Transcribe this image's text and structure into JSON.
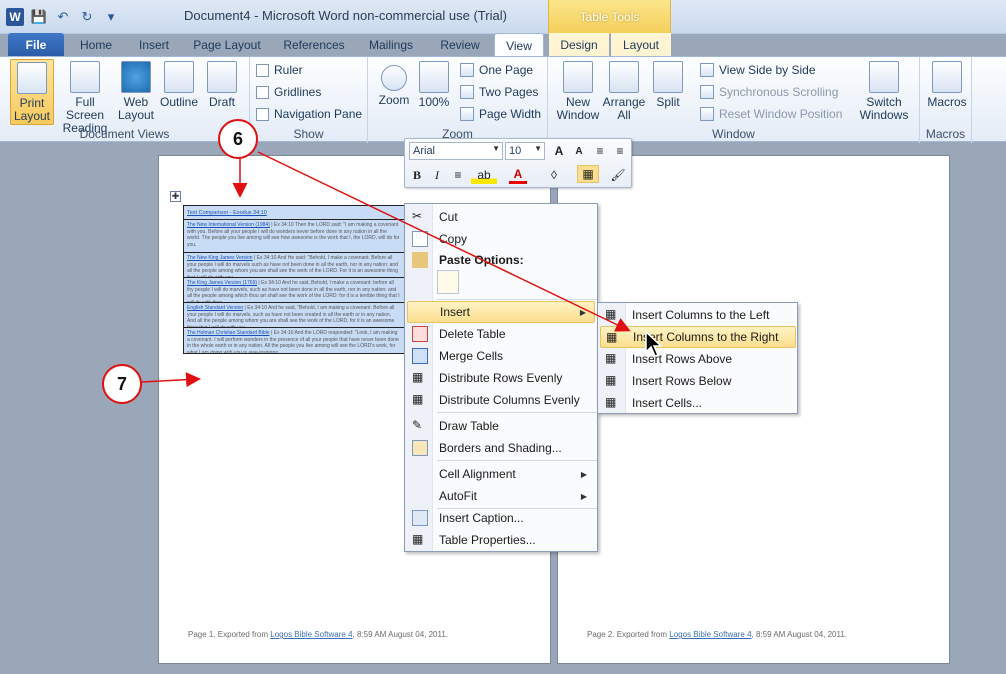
{
  "window": {
    "title": "Document4  -  Microsoft Word non-commercial use (Trial)",
    "context_tab_group": "Table Tools"
  },
  "tabs": [
    "File",
    "Home",
    "Insert",
    "Page Layout",
    "References",
    "Mailings",
    "Review",
    "View",
    "Design",
    "Layout"
  ],
  "active_tab": "View",
  "ribbon": {
    "document_views": {
      "label": "Document Views",
      "print_layout": "Print\nLayout",
      "full_screen_reading": "Full Screen\nReading",
      "web_layout": "Web\nLayout",
      "outline": "Outline",
      "draft": "Draft"
    },
    "show": {
      "label": "Show",
      "ruler": "Ruler",
      "gridlines": "Gridlines",
      "navigation_pane": "Navigation Pane"
    },
    "zoom": {
      "label": "Zoom",
      "zoom": "Zoom",
      "hundred": "100%",
      "one_page": "One Page",
      "two_pages": "Two Pages",
      "page_width": "Page Width"
    },
    "window": {
      "label": "Window",
      "new_window": "New\nWindow",
      "arrange_all": "Arrange\nAll",
      "split": "Split",
      "view_side_by_side": "View Side by Side",
      "synchronous_scrolling": "Synchronous Scrolling",
      "reset_window_position": "Reset Window Position",
      "switch_windows": "Switch\nWindows"
    },
    "macros": {
      "label": "Macros",
      "macros": "Macros"
    }
  },
  "mini_toolbar": {
    "font": "Arial",
    "size": "10"
  },
  "document": {
    "table_rows": [
      {
        "ref": "Text Comparison  -  Exodus 34:10",
        "text": ""
      },
      {
        "ref": "The New International Version (1984)",
        "text": " | Ex 34:10 Then the LORD said: \"I am making a covenant with you. Before all your people I will do wonders never before done in any nation in all the world. The people you live among will see how awesome is the work that I, the LORD, will do for you."
      },
      {
        "ref": "The New King James Version",
        "text": " | Ex 34:10 And He said: \"Behold, I make a covenant. Before all your people I will do marvels such as have not been done in all the earth, nor in any nation; and all the people among whom you are shall see the work of the LORD. For it is an awesome thing that I will do with you."
      },
      {
        "ref": "The King James Version (1769)",
        "text": " | Ex 34:10 And he said, Behold, I make a covenant: before all thy people I will do marvels, such as have not been done in all the earth, nor in any nation: and all the people among which thou art shall see the work of the LORD: for it is a terrible thing that I will do with thee."
      },
      {
        "ref": "English Standard Version",
        "text": " | Ex 34:10 And he said, \"Behold, I am making a covenant. Before all your people I will do marvels, such as have not been created in all the earth or in any nation. And all the people among whom you are shall see the work of the LORD, for it is an awesome thing that I will do with you."
      },
      {
        "ref": "The Holman Christian Standard Bible",
        "text": " | Ex 34:10 And the LORD responded: \"Look, I am making a covenant. I will perform wonders in the presence of all your people that have never been done in the whole earth or in any nation. All the people you live among will see the LORD's work, for what I am doing with you is awe-inspiring."
      }
    ],
    "footer_page1": {
      "prefix": "Page 1.  Exported from ",
      "link": "Logos Bible Software 4",
      "suffix": ", 8:59 AM August 04, 2011."
    },
    "footer_page2": {
      "prefix": "Page 2.  Exported from ",
      "link": "Logos Bible Software 4",
      "suffix": ", 8:59 AM August 04, 2011."
    }
  },
  "context_menu": {
    "cut": "Cut",
    "copy": "Copy",
    "paste_options": "Paste Options:",
    "insert": "Insert",
    "delete_table": "Delete Table",
    "merge_cells": "Merge Cells",
    "distribute_rows": "Distribute Rows Evenly",
    "distribute_columns": "Distribute Columns Evenly",
    "draw_table": "Draw Table",
    "borders_shading": "Borders and Shading...",
    "cell_alignment": "Cell Alignment",
    "autofit": "AutoFit",
    "insert_caption": "Insert Caption...",
    "table_properties": "Table Properties..."
  },
  "insert_submenu": {
    "cols_left": "Insert Columns to the Left",
    "cols_right": "Insert Columns to the Right",
    "rows_above": "Insert Rows Above",
    "rows_below": "Insert Rows Below",
    "cells": "Insert Cells..."
  },
  "callouts": {
    "six": "6",
    "seven": "7"
  }
}
